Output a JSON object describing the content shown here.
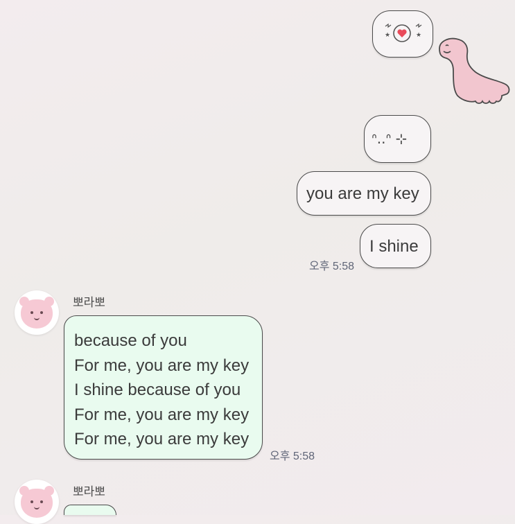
{
  "chat": {
    "outgoing": [
      {
        "type": "emoticon",
        "sticker": "sparkle-heart-emoticon"
      },
      {
        "type": "text",
        "text": "ᐢ..ᐢ ⊹"
      },
      {
        "type": "text",
        "text": "you are my key"
      },
      {
        "type": "text",
        "text": "I shine"
      }
    ],
    "outgoing_time": "오후 5:58",
    "incoming": [
      {
        "sender": "뽀라뽀",
        "lines": [
          "because of you",
          "For me, you are my key",
          "I shine because of you",
          "For me, you are my key",
          "For me, you are my key"
        ],
        "time": "오후 5:58"
      },
      {
        "sender": "뽀라뽀"
      }
    ]
  },
  "stickers": [
    "pink-dinosaur-sticker"
  ],
  "colors": {
    "outgoing_bubble": "#f7f4f5",
    "incoming_bubble": "#e9fbef",
    "bubble_border": "#4a4a4a",
    "avatar_pink": "#f6c9d4",
    "dino_pink": "#f2c6cf"
  }
}
